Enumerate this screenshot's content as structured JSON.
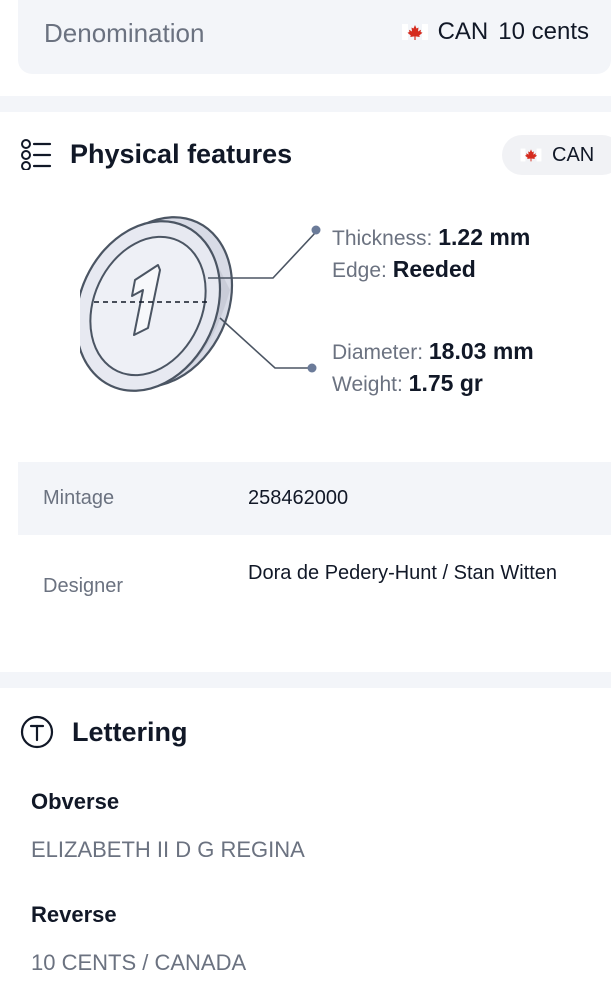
{
  "denomination": {
    "label": "Denomination",
    "country_code": "CAN",
    "value": "10 cents",
    "flag_icon": "canada-flag-icon"
  },
  "physical_features": {
    "title": "Physical features",
    "country_chip": "CAN",
    "thickness_label": "Thickness:",
    "thickness_value": "1.22 mm",
    "edge_label": "Edge:",
    "edge_value": "Reeded",
    "diameter_label": "Diameter:",
    "diameter_value": "18.03 mm",
    "weight_label": "Weight:",
    "weight_value": "1.75 gr"
  },
  "details": {
    "mintage_label": "Mintage",
    "mintage_value": "258462000",
    "designer_label": "Designer",
    "designer_value": "Dora de Pedery-Hunt / Stan Witten"
  },
  "lettering": {
    "title": "Lettering",
    "obverse_label": "Obverse",
    "obverse_text": "ELIZABETH II D G REGINA",
    "reverse_label": "Reverse",
    "reverse_text": "10 CENTS / CANADA"
  },
  "colors": {
    "card_bg": "#f3f5f9",
    "flag_red": "#d52b1e",
    "muted_text": "#6b7280",
    "primary_text": "#111827"
  }
}
